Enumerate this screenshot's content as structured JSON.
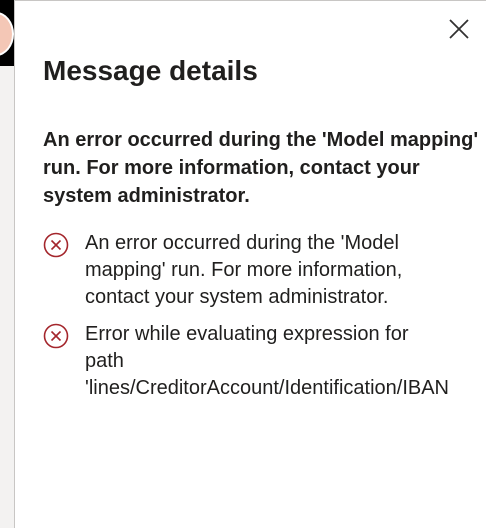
{
  "panel": {
    "title": "Message details",
    "close_label": "Close",
    "summary": "An error occurred during the 'Model mapping' run. For more information, contact your system administrator.",
    "messages": [
      {
        "icon": "error-circle-icon",
        "line1": "An error occurred during the 'Model",
        "line2": "mapping' run. For more information,",
        "line3": "contact your system administrator."
      },
      {
        "icon": "error-circle-icon",
        "line1": "Error while evaluating expression for",
        "line2": "path",
        "line3": "'lines/CreditorAccount/Identification/IBAN"
      }
    ]
  },
  "colors": {
    "error": "#a4262c",
    "text": "#201f1e",
    "app_bar": "#000000"
  }
}
